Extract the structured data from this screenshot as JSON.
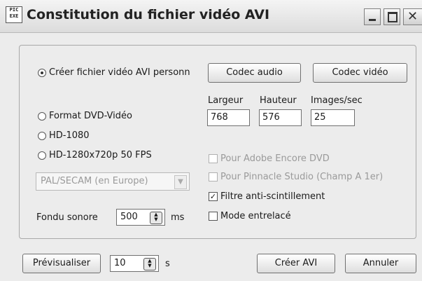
{
  "window": {
    "title": "Constitution du fichier vidéo AVI",
    "icon_text": "PIC\nEXE"
  },
  "options": {
    "custom_avi": "Créer fichier vidéo AVI personn",
    "dvd_video": "Format DVD-Vidéo",
    "hd1080": "HD-1080",
    "hd720": "HD-1280x720p 50 FPS",
    "selected": "custom_avi"
  },
  "buttons": {
    "codec_audio": "Codec audio",
    "codec_video": "Codec vidéo",
    "preview": "Prévisualiser",
    "create": "Créer AVI",
    "cancel": "Annuler"
  },
  "dimensions": {
    "width_label": "Largeur",
    "height_label": "Hauteur",
    "fps_label": "Images/sec",
    "width": "768",
    "height": "576",
    "fps": "25"
  },
  "standard_select": {
    "value": "PAL/SECAM (en Europe)"
  },
  "checkboxes": {
    "adobe_encore": {
      "label": "Pour Adobe Encore DVD",
      "checked": false,
      "enabled": false
    },
    "pinnacle": {
      "label": "Pour Pinnacle Studio (Champ A 1er)",
      "checked": false,
      "enabled": false
    },
    "anti_flicker": {
      "label": "Filtre anti-scintillement",
      "checked": true,
      "enabled": true
    },
    "interlaced": {
      "label": "Mode entrelacé",
      "checked": false,
      "enabled": true
    }
  },
  "fade": {
    "label": "Fondu sonore",
    "value": "500",
    "unit": "ms"
  },
  "preview": {
    "value": "10",
    "unit": "s"
  }
}
